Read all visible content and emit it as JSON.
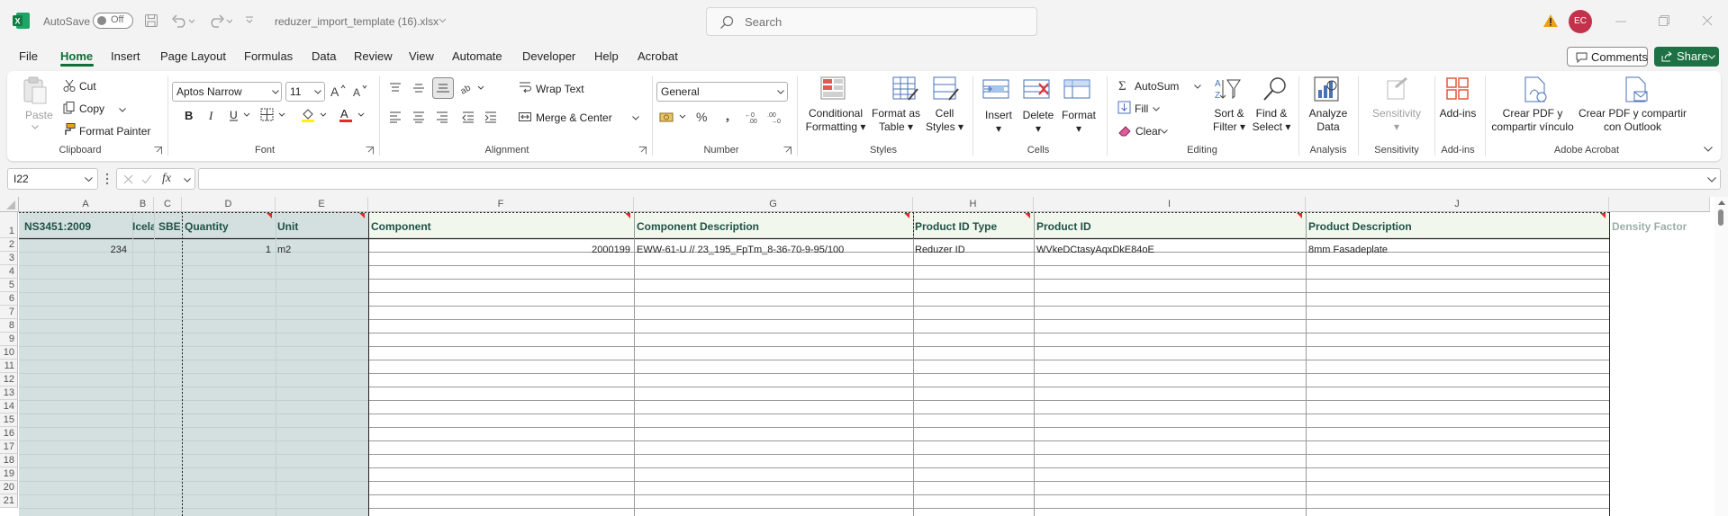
{
  "titlebar": {
    "autosave_label": "AutoSave",
    "autosave_state": "Off",
    "filename": "reduzer_import_template (16).xlsx",
    "search_placeholder": "Search",
    "user_initials": "EC"
  },
  "tabs": [
    "File",
    "Home",
    "Insert",
    "Page Layout",
    "Formulas",
    "Data",
    "Review",
    "View",
    "Automate",
    "Developer",
    "Help",
    "Acrobat"
  ],
  "active_tab": "Home",
  "actions": {
    "comments": "Comments",
    "share": "Share"
  },
  "ribbon": {
    "clipboard": {
      "label": "Clipboard",
      "paste": "Paste",
      "cut": "Cut",
      "copy": "Copy",
      "format_painter": "Format Painter"
    },
    "font": {
      "label": "Font",
      "family": "Aptos Narrow",
      "size": "11"
    },
    "alignment": {
      "label": "Alignment",
      "wrap_text": "Wrap Text",
      "merge_center": "Merge & Center"
    },
    "number": {
      "label": "Number",
      "format": "General"
    },
    "styles": {
      "label": "Styles",
      "conditional_1": "Conditional",
      "conditional_2": "Formatting",
      "format_table_1": "Format as",
      "format_table_2": "Table",
      "cell_styles_1": "Cell",
      "cell_styles_2": "Styles"
    },
    "cells": {
      "label": "Cells",
      "insert": "Insert",
      "delete": "Delete",
      "format": "Format"
    },
    "editing": {
      "label": "Editing",
      "autosum": "AutoSum",
      "fill": "Fill",
      "clear": "Clear",
      "sort_1": "Sort &",
      "sort_2": "Filter",
      "find_1": "Find &",
      "find_2": "Select"
    },
    "analysis": {
      "label": "Analysis",
      "analyze_1": "Analyze",
      "analyze_2": "Data"
    },
    "sensitivity": {
      "label": "Sensitivity",
      "button": "Sensitivity"
    },
    "addins": {
      "label": "Add-ins",
      "button": "Add-ins"
    },
    "acrobat": {
      "label": "Adobe Acrobat",
      "pdf_link_1": "Crear PDF y",
      "pdf_link_2": "compartir vínculo",
      "pdf_outlook_1": "Crear PDF y compartir",
      "pdf_outlook_2": "con Outlook"
    }
  },
  "formula_bar": {
    "name_box": "I22",
    "fx": "fx",
    "value": ""
  },
  "sheet": {
    "columns": [
      "A",
      "B",
      "C",
      "D",
      "E",
      "F",
      "G",
      "H",
      "I",
      "J"
    ],
    "header_row": [
      "NS3451:2009",
      "Icela",
      "SBE",
      "Quantity",
      "Unit",
      "Component",
      "Component Description",
      "Product ID Type",
      "Product ID",
      "Product Description",
      "Density Factor"
    ],
    "row2": {
      "A": "234",
      "D": "1",
      "E": "m2",
      "F": "2000199",
      "G": "EWW-61-U // 23_195_FpTm_8-36-70-9-95/100",
      "H": "Reduzer ID",
      "I": "WVkeDCtasyAqxDkE84oE",
      "J": "8mm Fasadeplate"
    },
    "row_numbers": [
      "1",
      "2",
      "3",
      "4",
      "5",
      "6",
      "7",
      "8",
      "9",
      "10",
      "11",
      "12",
      "13",
      "14",
      "15",
      "16",
      "17",
      "18",
      "19",
      "20",
      "21"
    ]
  }
}
